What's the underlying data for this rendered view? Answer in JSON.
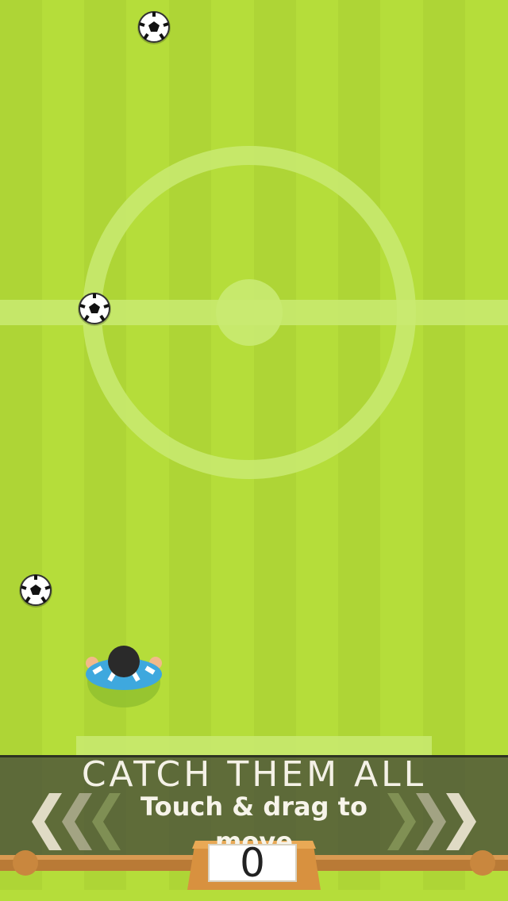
{
  "game": {
    "title": "CATCH THEM ALL",
    "instruction_line1": "Touch & drag to",
    "instruction_line2": "move",
    "score": "0"
  },
  "balls": [
    {
      "name": "falling-ball-1"
    },
    {
      "name": "falling-ball-2"
    },
    {
      "name": "falling-ball-3"
    }
  ],
  "icons": {
    "ball": "soccer-ball-icon",
    "player": "player-icon",
    "left_arrows": "chevron-left-icon",
    "right_arrows": "chevron-right-icon"
  },
  "colors": {
    "pitch_light": "#b8e03c",
    "pitch_dark": "#a9d632",
    "pitch_lines": "#cfee84",
    "panel_text": "#f4f1e6",
    "jersey": "#3ea8de",
    "board_wood": "#c9873e"
  }
}
